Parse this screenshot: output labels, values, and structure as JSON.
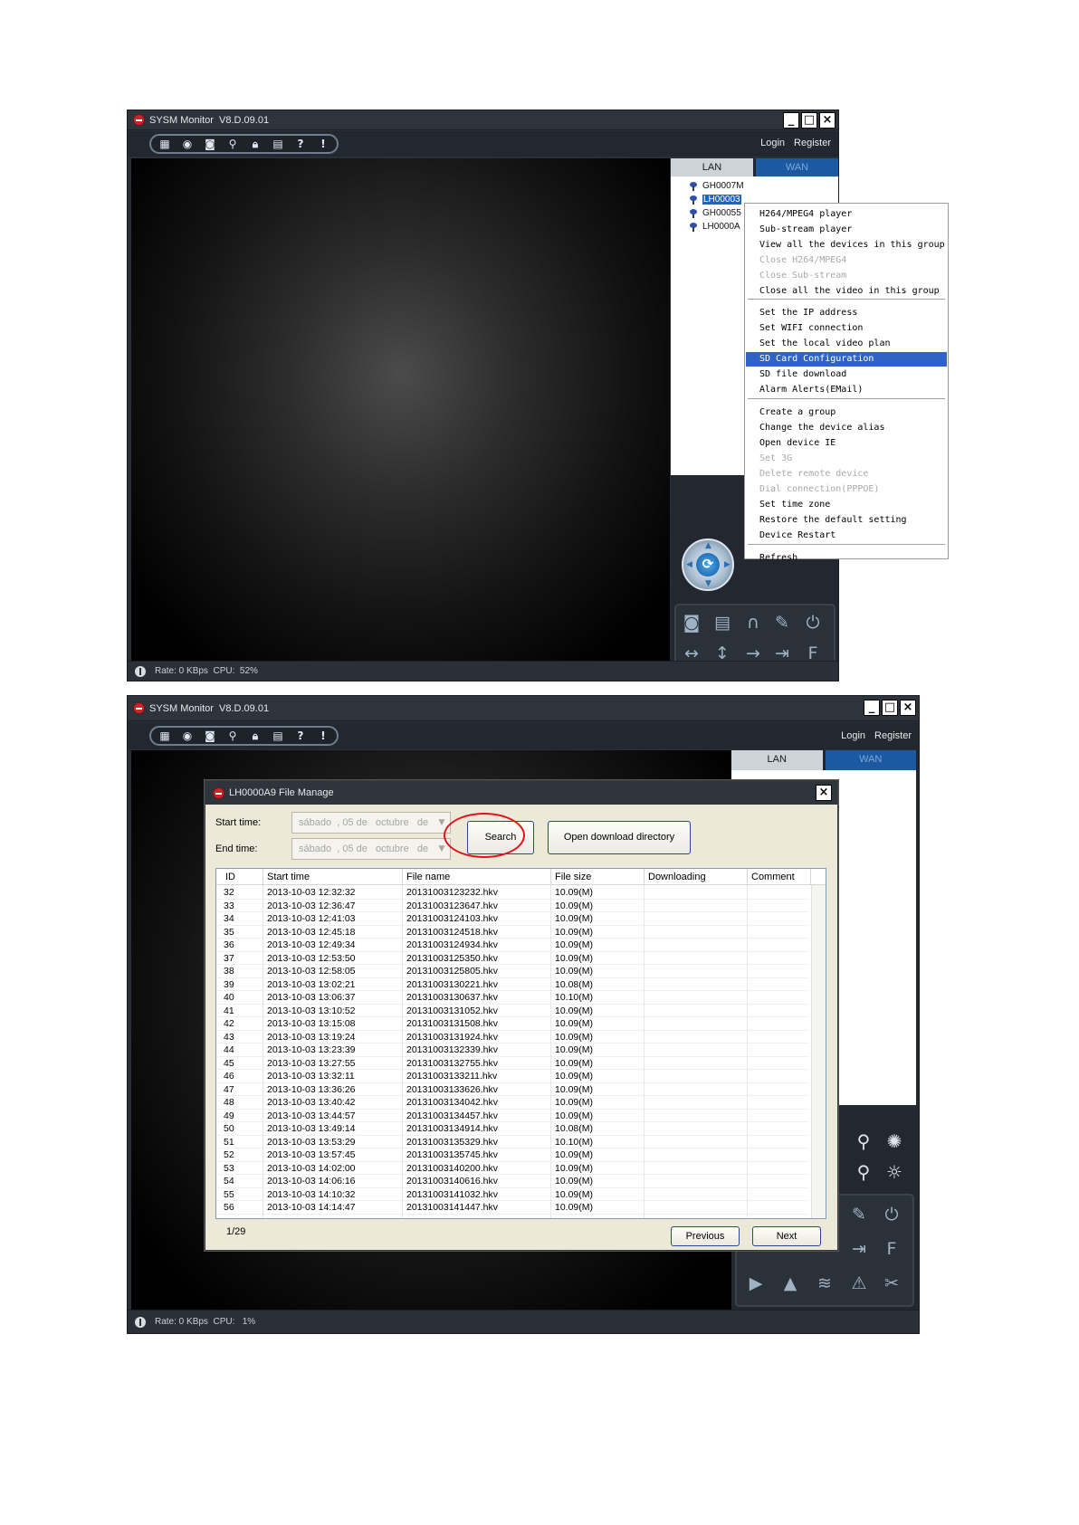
{
  "window1": {
    "title": "SYSM Monitor  V8.D.09.01",
    "login": "Login",
    "register": "Register",
    "tab_lan": "LAN",
    "tab_wan": "WAN",
    "devices": [
      "GH0007M",
      "LH00003",
      "GH00055",
      "LH0000A"
    ],
    "status": "Rate: 0 KBps  CPU:  52%",
    "context_menu": [
      {
        "label": "H264/MPEG4 player",
        "state": "normal"
      },
      {
        "label": "Sub-stream player",
        "state": "normal"
      },
      {
        "label": "View all the devices in this group",
        "state": "normal"
      },
      {
        "label": "Close H264/MPEG4",
        "state": "disabled"
      },
      {
        "label": "Close Sub-stream",
        "state": "disabled"
      },
      {
        "label": "Close all the video in this group",
        "state": "normal"
      },
      {
        "label": "Set the IP address",
        "state": "normal"
      },
      {
        "label": "Set WIFI connection",
        "state": "normal"
      },
      {
        "label": "Set the local video plan",
        "state": "normal"
      },
      {
        "label": "SD Card Configuration",
        "state": "selected"
      },
      {
        "label": "SD file download",
        "state": "normal"
      },
      {
        "label": "Alarm Alerts(EMail)",
        "state": "normal"
      },
      {
        "label": "Create a group",
        "state": "normal"
      },
      {
        "label": "Change the device alias",
        "state": "normal"
      },
      {
        "label": "Open device IE",
        "state": "normal"
      },
      {
        "label": "Set 3G",
        "state": "disabled"
      },
      {
        "label": "Delete remote device",
        "state": "disabled"
      },
      {
        "label": "Dial connection(PPPOE)",
        "state": "disabled"
      },
      {
        "label": "Set time zone",
        "state": "normal"
      },
      {
        "label": "Restore the default setting",
        "state": "normal"
      },
      {
        "label": "Device Restart",
        "state": "normal"
      },
      {
        "label": "Refresh",
        "state": "normal"
      }
    ]
  },
  "window2": {
    "title": "SYSM Monitor  V8.D.09.01",
    "login": "Login",
    "register": "Register",
    "tab_lan": "LAN",
    "tab_wan": "WAN",
    "status": "Rate: 0 KBps  CPU:   1%"
  },
  "dialog": {
    "title": "LH0000A9 File Manage",
    "start_label": "Start time:",
    "end_label": "End time:",
    "start_value": "sábado  , 05 de   octubre   de",
    "end_value": "sábado  , 05 de   octubre   de",
    "search_button": "Search",
    "open_dir_button": "Open download directory",
    "columns": [
      "ID",
      "Start time",
      "File name",
      "File size",
      "Downloading",
      "Comment"
    ],
    "rows": [
      [
        "32",
        "2013-10-03 12:32:32",
        "20131003123232.hkv",
        "10.09(M)"
      ],
      [
        "33",
        "2013-10-03 12:36:47",
        "20131003123647.hkv",
        "10.09(M)"
      ],
      [
        "34",
        "2013-10-03 12:41:03",
        "20131003124103.hkv",
        "10.09(M)"
      ],
      [
        "35",
        "2013-10-03 12:45:18",
        "20131003124518.hkv",
        "10.09(M)"
      ],
      [
        "36",
        "2013-10-03 12:49:34",
        "20131003124934.hkv",
        "10.09(M)"
      ],
      [
        "37",
        "2013-10-03 12:53:50",
        "20131003125350.hkv",
        "10.09(M)"
      ],
      [
        "38",
        "2013-10-03 12:58:05",
        "20131003125805.hkv",
        "10.09(M)"
      ],
      [
        "39",
        "2013-10-03 13:02:21",
        "20131003130221.hkv",
        "10.08(M)"
      ],
      [
        "40",
        "2013-10-03 13:06:37",
        "20131003130637.hkv",
        "10.10(M)"
      ],
      [
        "41",
        "2013-10-03 13:10:52",
        "20131003131052.hkv",
        "10.09(M)"
      ],
      [
        "42",
        "2013-10-03 13:15:08",
        "20131003131508.hkv",
        "10.09(M)"
      ],
      [
        "43",
        "2013-10-03 13:19:24",
        "20131003131924.hkv",
        "10.09(M)"
      ],
      [
        "44",
        "2013-10-03 13:23:39",
        "20131003132339.hkv",
        "10.09(M)"
      ],
      [
        "45",
        "2013-10-03 13:27:55",
        "20131003132755.hkv",
        "10.09(M)"
      ],
      [
        "46",
        "2013-10-03 13:32:11",
        "20131003133211.hkv",
        "10.09(M)"
      ],
      [
        "47",
        "2013-10-03 13:36:26",
        "20131003133626.hkv",
        "10.09(M)"
      ],
      [
        "48",
        "2013-10-03 13:40:42",
        "20131003134042.hkv",
        "10.09(M)"
      ],
      [
        "49",
        "2013-10-03 13:44:57",
        "20131003134457.hkv",
        "10.09(M)"
      ],
      [
        "50",
        "2013-10-03 13:49:14",
        "20131003134914.hkv",
        "10.08(M)"
      ],
      [
        "51",
        "2013-10-03 13:53:29",
        "20131003135329.hkv",
        "10.10(M)"
      ],
      [
        "52",
        "2013-10-03 13:57:45",
        "20131003135745.hkv",
        "10.09(M)"
      ],
      [
        "53",
        "2013-10-03 14:02:00",
        "20131003140200.hkv",
        "10.09(M)"
      ],
      [
        "54",
        "2013-10-03 14:06:16",
        "20131003140616.hkv",
        "10.09(M)"
      ],
      [
        "55",
        "2013-10-03 14:10:32",
        "20131003141032.hkv",
        "10.09(M)"
      ],
      [
        "56",
        "2013-10-03 14:14:47",
        "20131003141447.hkv",
        "10.09(M)"
      ]
    ],
    "page_info": "1/29",
    "previous_button": "Previous",
    "next_button": "Next"
  }
}
